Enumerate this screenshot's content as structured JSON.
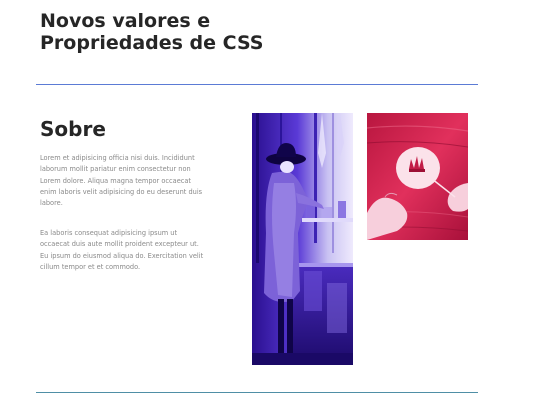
{
  "header": {
    "title_line1": "Novos valores e",
    "title_line2": "Propriedades de CSS"
  },
  "about": {
    "title": "Sobre",
    "paragraph1_lines": [
      "Lorem et adipisicing officia nisi duis. Incididunt",
      "laborum mollit pariatur enim consectetur non",
      "Lorem dolore. Aliqua magna tempor occaecat",
      "enim laboris velit adipisicing do eu deserunt duis",
      "labore."
    ],
    "paragraph2_lines": [
      "Ea laboris consequat adipisicing ipsum ut",
      "occaecat duis aute mollit proident excepteur ut.",
      "Eu ipsum do eiusmod aliqua do. Exercitation velit",
      "cillum tempor et et commodo."
    ]
  },
  "images": {
    "woman_photo": "woman-in-hat-purple-duotone",
    "hands_photo": "hands-holding-plate-pink-duotone"
  },
  "colors": {
    "divider_top": "#5b7bd5",
    "divider_bottom": "#4f8fa6",
    "purple_duotone": "#3a1db0",
    "pink_duotone": "#d5234f"
  }
}
